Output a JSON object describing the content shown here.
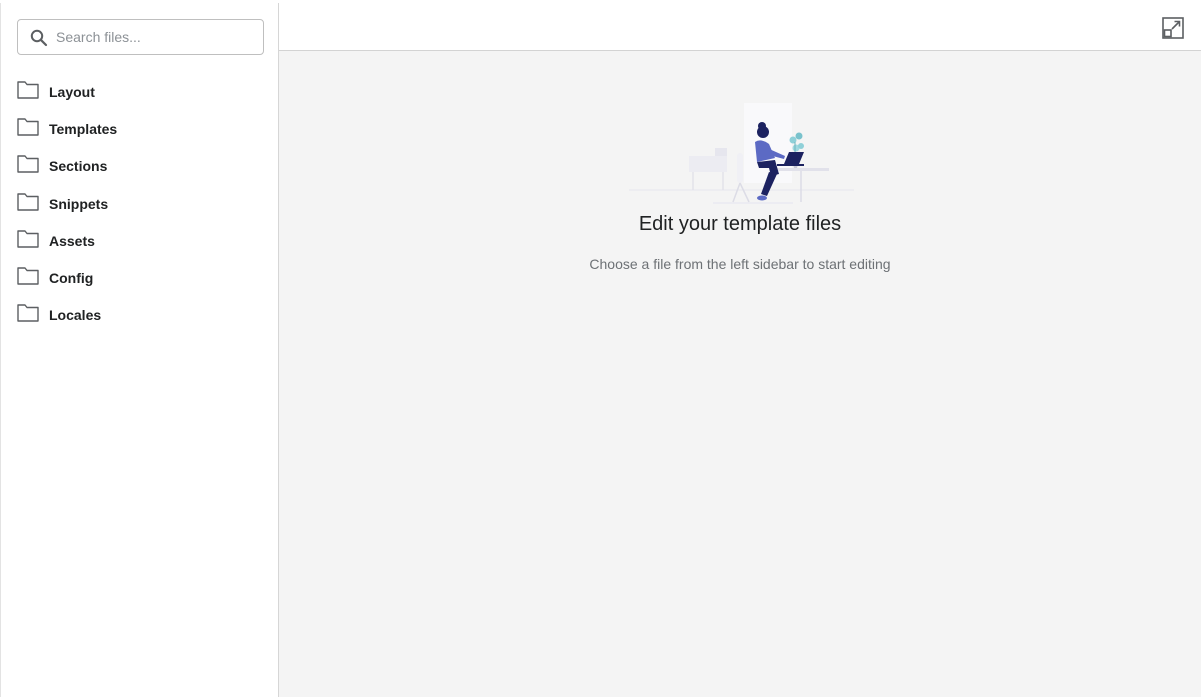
{
  "search": {
    "placeholder": "Search files...",
    "value": ""
  },
  "folders": [
    {
      "label": "Layout",
      "icon": "folder-icon"
    },
    {
      "label": "Templates",
      "icon": "folder-icon"
    },
    {
      "label": "Sections",
      "icon": "folder-icon"
    },
    {
      "label": "Snippets",
      "icon": "folder-icon"
    },
    {
      "label": "Assets",
      "icon": "folder-icon"
    },
    {
      "label": "Config",
      "icon": "folder-icon"
    },
    {
      "label": "Locales",
      "icon": "folder-icon"
    }
  ],
  "toolbar": {
    "expand_icon": "expand-icon"
  },
  "empty_state": {
    "title": "Edit your template files",
    "subtitle": "Choose a file from the left sidebar to start editing",
    "illustration": "person-working-at-laptop"
  },
  "colors": {
    "illustration_accent": "#5c6ac4",
    "illustration_dark": "#1c2260",
    "main_background": "#f4f4f4"
  }
}
